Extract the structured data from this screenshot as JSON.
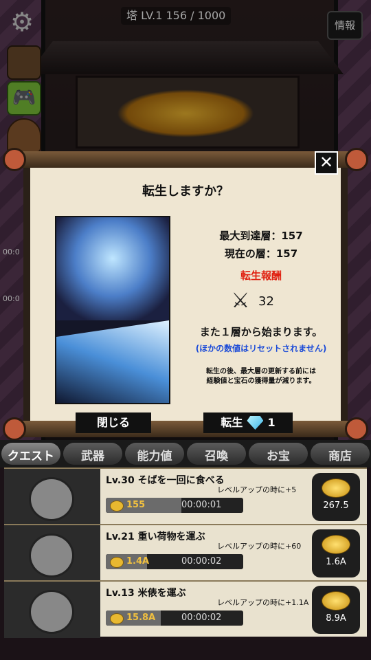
{
  "hud": {
    "tower_label": "塔 LV.1   156 / 1000",
    "info_label": "情報"
  },
  "dialog": {
    "title": "転生しますか？",
    "max_floor": "最大到達層：157",
    "current_floor": "現在の層：157",
    "reward_title": "転生報酬",
    "reward_value": "32",
    "restart_note": "また１層から始まります。",
    "no_reset_note": "(ほかの数値はリセットされません)",
    "warning_line1": "転生の後、最大層の更新する前には",
    "warning_line2": "経験値と宝石の獲得量が減ります。",
    "close_label": "閉じる",
    "rebirth_label": "転生",
    "rebirth_cost": "1"
  },
  "tabs": [
    {
      "label": "クエスト"
    },
    {
      "label": "武器"
    },
    {
      "label": "能力値"
    },
    {
      "label": "召喚"
    },
    {
      "label": "お宝"
    },
    {
      "label": "商店"
    }
  ],
  "quests": [
    {
      "name": "Lv.30 そばを一回に食べる",
      "bonus": "レベルアップの時に+5",
      "cost": "155",
      "time": "00:00:01",
      "upgrade": "267.5",
      "progress": 0.55
    },
    {
      "name": "Lv.21 重い荷物を運ぶ",
      "bonus": "レベルアップの時に+60",
      "cost": "1.4A",
      "time": "00:00:02",
      "upgrade": "1.6A",
      "progress": 0.3
    },
    {
      "name": "Lv.13 米俵を運ぶ",
      "bonus": "レベルアップの時に+1.1A",
      "cost": "15.8A",
      "time": "00:00:02",
      "upgrade": "8.9A",
      "progress": 0.4
    }
  ],
  "side_text": {
    "a": "00:0",
    "b": "00:0"
  },
  "colors": {
    "reward_red": "#e02010",
    "note_blue": "#1a4ad8",
    "paper": "#efe6d2"
  }
}
